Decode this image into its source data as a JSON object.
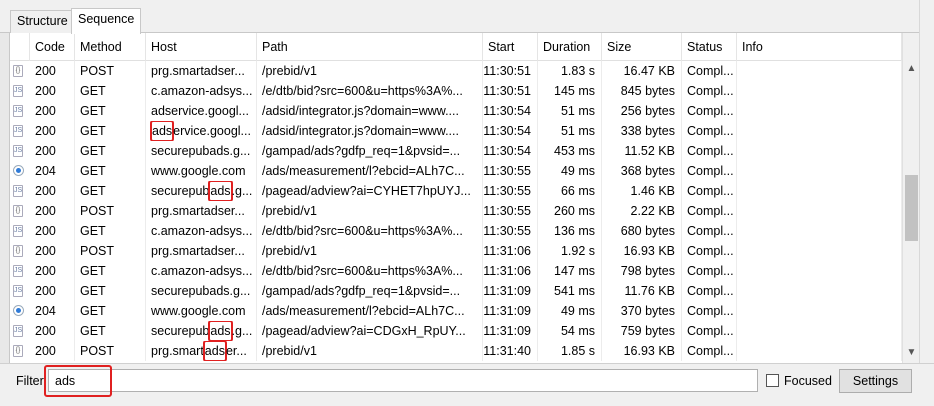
{
  "tabs": [
    {
      "label": "Structure",
      "active": false
    },
    {
      "label": "Sequence",
      "active": true
    }
  ],
  "columns": [
    "Code",
    "Method",
    "Host",
    "Path",
    "Start",
    "Duration",
    "Size",
    "Status",
    "Info"
  ],
  "rows": [
    {
      "icon": "json-file-icon",
      "code": "200",
      "method": "POST",
      "host": "prg.smartadser...",
      "path": "/prebid/v1",
      "start": "11:30:51",
      "duration": "1.83 s",
      "size": "16.47 KB",
      "status": "Compl..."
    },
    {
      "icon": "script-file-icon",
      "code": "200",
      "method": "GET",
      "host": "c.amazon-adsys...",
      "path": "/e/dtb/bid?src=600&u=https%3A%...",
      "start": "11:30:51",
      "duration": "145 ms",
      "size": "845 bytes",
      "status": "Compl..."
    },
    {
      "icon": "script-file-icon",
      "code": "200",
      "method": "GET",
      "host": "adservice.googl...",
      "path": "/adsid/integrator.js?domain=www....",
      "start": "11:30:54",
      "duration": "51 ms",
      "size": "256 bytes",
      "status": "Compl..."
    },
    {
      "icon": "script-file-icon",
      "code": "200",
      "method": "GET",
      "host": "adservice.googl...",
      "path": "/adsid/integrator.js?domain=www....",
      "start": "11:30:54",
      "duration": "51 ms",
      "size": "338 bytes",
      "status": "Compl..."
    },
    {
      "icon": "script-file-icon",
      "code": "200",
      "method": "GET",
      "host": "securepubads.g...",
      "path": "/gampad/ads?gdfp_req=1&pvsid=...",
      "start": "11:30:54",
      "duration": "453 ms",
      "size": "11.52 KB",
      "status": "Compl..."
    },
    {
      "icon": "request-dot-icon",
      "code": "204",
      "method": "GET",
      "host": "www.google.com",
      "path": "/ads/measurement/l?ebcid=ALh7C...",
      "start": "11:30:55",
      "duration": "49 ms",
      "size": "368 bytes",
      "status": "Compl..."
    },
    {
      "icon": "script-file-icon",
      "code": "200",
      "method": "GET",
      "host": "securepubads.g...",
      "path": "/pagead/adview?ai=CYHET7hpUYJ...",
      "start": "11:30:55",
      "duration": "66 ms",
      "size": "1.46 KB",
      "status": "Compl..."
    },
    {
      "icon": "json-file-icon",
      "code": "200",
      "method": "POST",
      "host": "prg.smartadser...",
      "path": "/prebid/v1",
      "start": "11:30:55",
      "duration": "260 ms",
      "size": "2.22 KB",
      "status": "Compl..."
    },
    {
      "icon": "script-file-icon",
      "code": "200",
      "method": "GET",
      "host": "c.amazon-adsys...",
      "path": "/e/dtb/bid?src=600&u=https%3A%...",
      "start": "11:30:55",
      "duration": "136 ms",
      "size": "680 bytes",
      "status": "Compl..."
    },
    {
      "icon": "json-file-icon",
      "code": "200",
      "method": "POST",
      "host": "prg.smartadser...",
      "path": "/prebid/v1",
      "start": "11:31:06",
      "duration": "1.92 s",
      "size": "16.93 KB",
      "status": "Compl..."
    },
    {
      "icon": "script-file-icon",
      "code": "200",
      "method": "GET",
      "host": "c.amazon-adsys...",
      "path": "/e/dtb/bid?src=600&u=https%3A%...",
      "start": "11:31:06",
      "duration": "147 ms",
      "size": "798 bytes",
      "status": "Compl..."
    },
    {
      "icon": "script-file-icon",
      "code": "200",
      "method": "GET",
      "host": "securepubads.g...",
      "path": "/gampad/ads?gdfp_req=1&pvsid=...",
      "start": "11:31:09",
      "duration": "541 ms",
      "size": "11.76 KB",
      "status": "Compl..."
    },
    {
      "icon": "request-dot-icon",
      "code": "204",
      "method": "GET",
      "host": "www.google.com",
      "path": "/ads/measurement/l?ebcid=ALh7C...",
      "start": "11:31:09",
      "duration": "49 ms",
      "size": "370 bytes",
      "status": "Compl..."
    },
    {
      "icon": "script-file-icon",
      "code": "200",
      "method": "GET",
      "host": "securepubads.g...",
      "path": "/pagead/adview?ai=CDGxH_RpUY...",
      "start": "11:31:09",
      "duration": "54 ms",
      "size": "759 bytes",
      "status": "Compl..."
    },
    {
      "icon": "json-file-icon",
      "code": "200",
      "method": "POST",
      "host": "prg.smartadser...",
      "path": "/prebid/v1",
      "start": "11:31:40",
      "duration": "1.85 s",
      "size": "16.93 KB",
      "status": "Compl..."
    }
  ],
  "highlights": {
    "3": {
      "text": "ads",
      "mode": "prefix"
    },
    "6": {
      "text": "ads",
      "mode": "mid"
    },
    "13": {
      "text": "ads",
      "mode": "mid"
    },
    "14": {
      "text": "ads",
      "mode": "mid"
    }
  },
  "filter": {
    "label": "Filter",
    "value": "ads"
  },
  "focused": {
    "label": "Focused",
    "checked": false
  },
  "settings_label": "Settings",
  "colors": {
    "highlight": "#e02020",
    "request_dot": "#2f7bd8"
  }
}
